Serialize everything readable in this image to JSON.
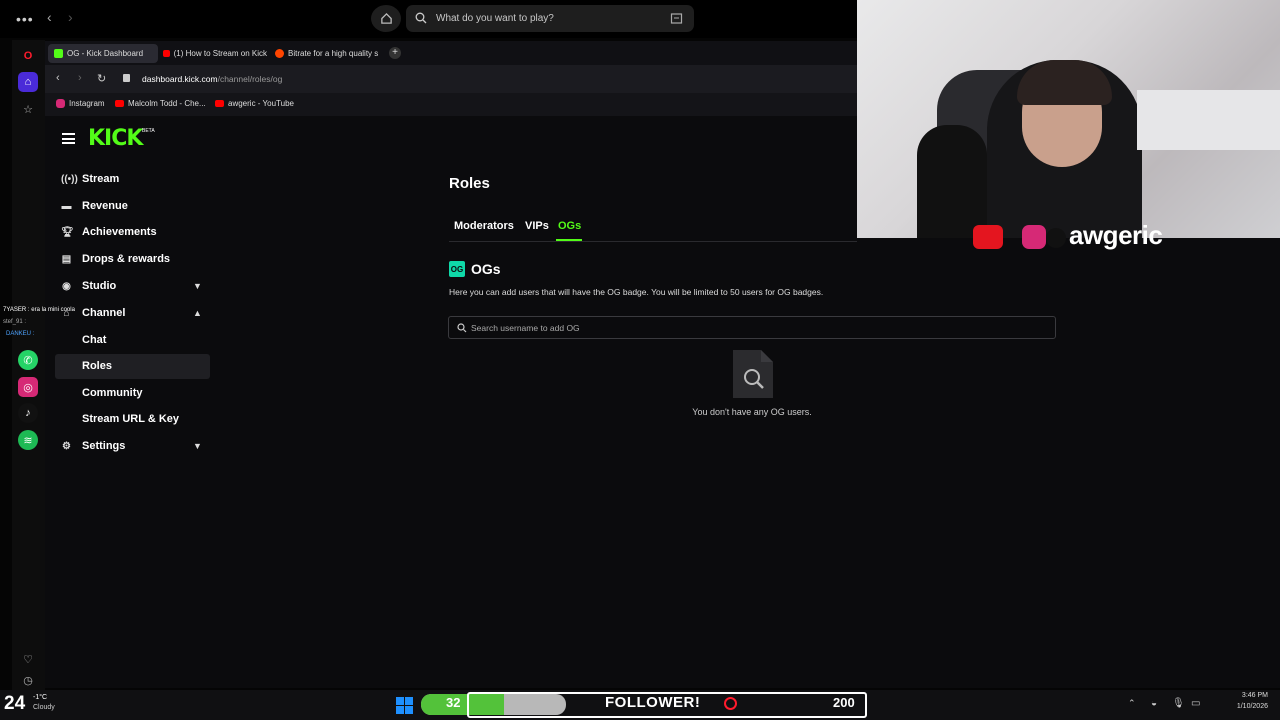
{
  "browser": {
    "search_placeholder": "What do you want to play?",
    "tabs": [
      {
        "label": "OG - Kick Dashboard",
        "favicon": "kick-icon",
        "color": "#53fc18"
      },
      {
        "label": "(1) How to Stream on Kick",
        "favicon": "youtube-icon",
        "color": "#ff0000"
      },
      {
        "label": "Bitrate for a high quality s",
        "favicon": "reddit-icon",
        "color": "#ff4500"
      }
    ],
    "url_domain": "dashboard.kick.com",
    "url_path": "/channel/roles/og",
    "bookmarks": [
      {
        "label": "Instagram",
        "icon": "instagram-icon"
      },
      {
        "label": "Malcolm Todd - Che...",
        "icon": "youtube-icon"
      },
      {
        "label": "awgeric - YouTube",
        "icon": "youtube-icon"
      }
    ]
  },
  "sidebar": {
    "logo": "KICK",
    "logo_badge": "BETA",
    "items": [
      {
        "label": "Stream",
        "icon": "stream-icon"
      },
      {
        "label": "Revenue",
        "icon": "wallet-icon"
      },
      {
        "label": "Achievements",
        "icon": "trophy-icon"
      },
      {
        "label": "Drops & rewards",
        "icon": "gift-icon"
      },
      {
        "label": "Studio",
        "icon": "studio-icon"
      },
      {
        "label": "Channel",
        "icon": "channel-icon"
      },
      {
        "label": "Settings",
        "icon": "gear-icon"
      }
    ],
    "channel_sub": [
      "Chat",
      "Roles",
      "Community",
      "Stream URL & Key"
    ]
  },
  "main": {
    "title": "Roles",
    "tabs": [
      "Moderators",
      "VIPs",
      "OGs"
    ],
    "section_badge": "OG",
    "section_title": "OGs",
    "description": "Here you can add users that will have the OG badge. You will be limited to 50 users for OG badges.",
    "search_placeholder": "Search username to add OG",
    "empty_text": "You don't have any OG users."
  },
  "overlay": {
    "chat_line1": "7YASER : era la mini coola",
    "chat_line2": "stef_91 : ",
    "chat_line3": "DANKEU : ",
    "channel_name": "awgeric",
    "follower_label": "FOLLOWER!",
    "goal_current": "32",
    "goal_target": "200"
  },
  "taskbar": {
    "weather_temp_big": "24",
    "weather_temp": "-1°C",
    "weather_desc": "Cloudy",
    "time": "3:46 PM",
    "date": "1/10/2026"
  },
  "colors": {
    "accent": "#53fc18",
    "page_bg": "#0b0b0d"
  }
}
